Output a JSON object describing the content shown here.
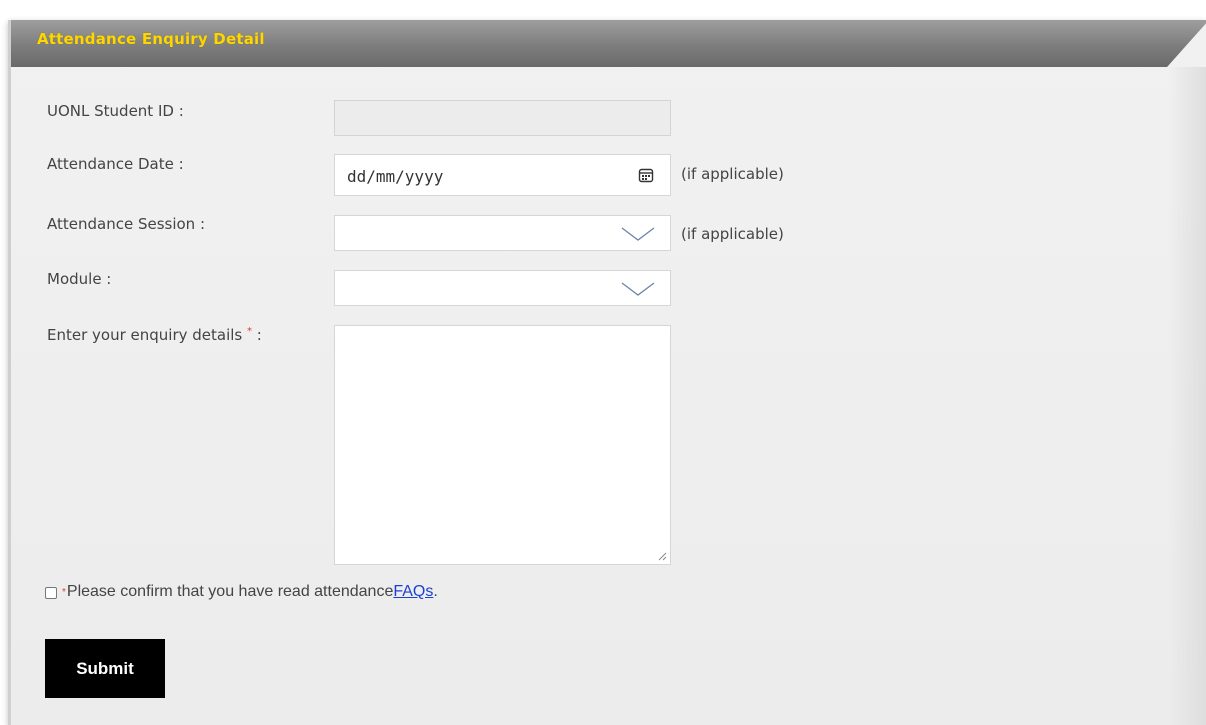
{
  "header": {
    "title": "Attendance Enquiry Detail"
  },
  "form": {
    "student_id": {
      "label": "UONL Student ID :",
      "value": ""
    },
    "attendance_date": {
      "label": "Attendance Date :",
      "placeholder": "dd/mm/yyyy",
      "hint": "(if applicable)"
    },
    "attendance_session": {
      "label": "Attendance Session :",
      "value": "",
      "hint": "(if applicable)"
    },
    "module": {
      "label": "Module :",
      "value": ""
    },
    "enquiry": {
      "label": "Enter your enquiry details",
      "required_mark": "*",
      "suffix": " :",
      "value": ""
    },
    "confirm": {
      "required_mark": "*",
      "text": "Please confirm that you have read attendance ",
      "link_text": "FAQs",
      "after": "."
    },
    "submit_label": "Submit"
  },
  "icons": {
    "calendar": "calendar-icon",
    "dropdown": "chevron-down-icon"
  },
  "colors": {
    "header_title": "#ffd700",
    "submit_bg": "#000000",
    "link": "#1a3fd6",
    "required": "#e53935"
  }
}
